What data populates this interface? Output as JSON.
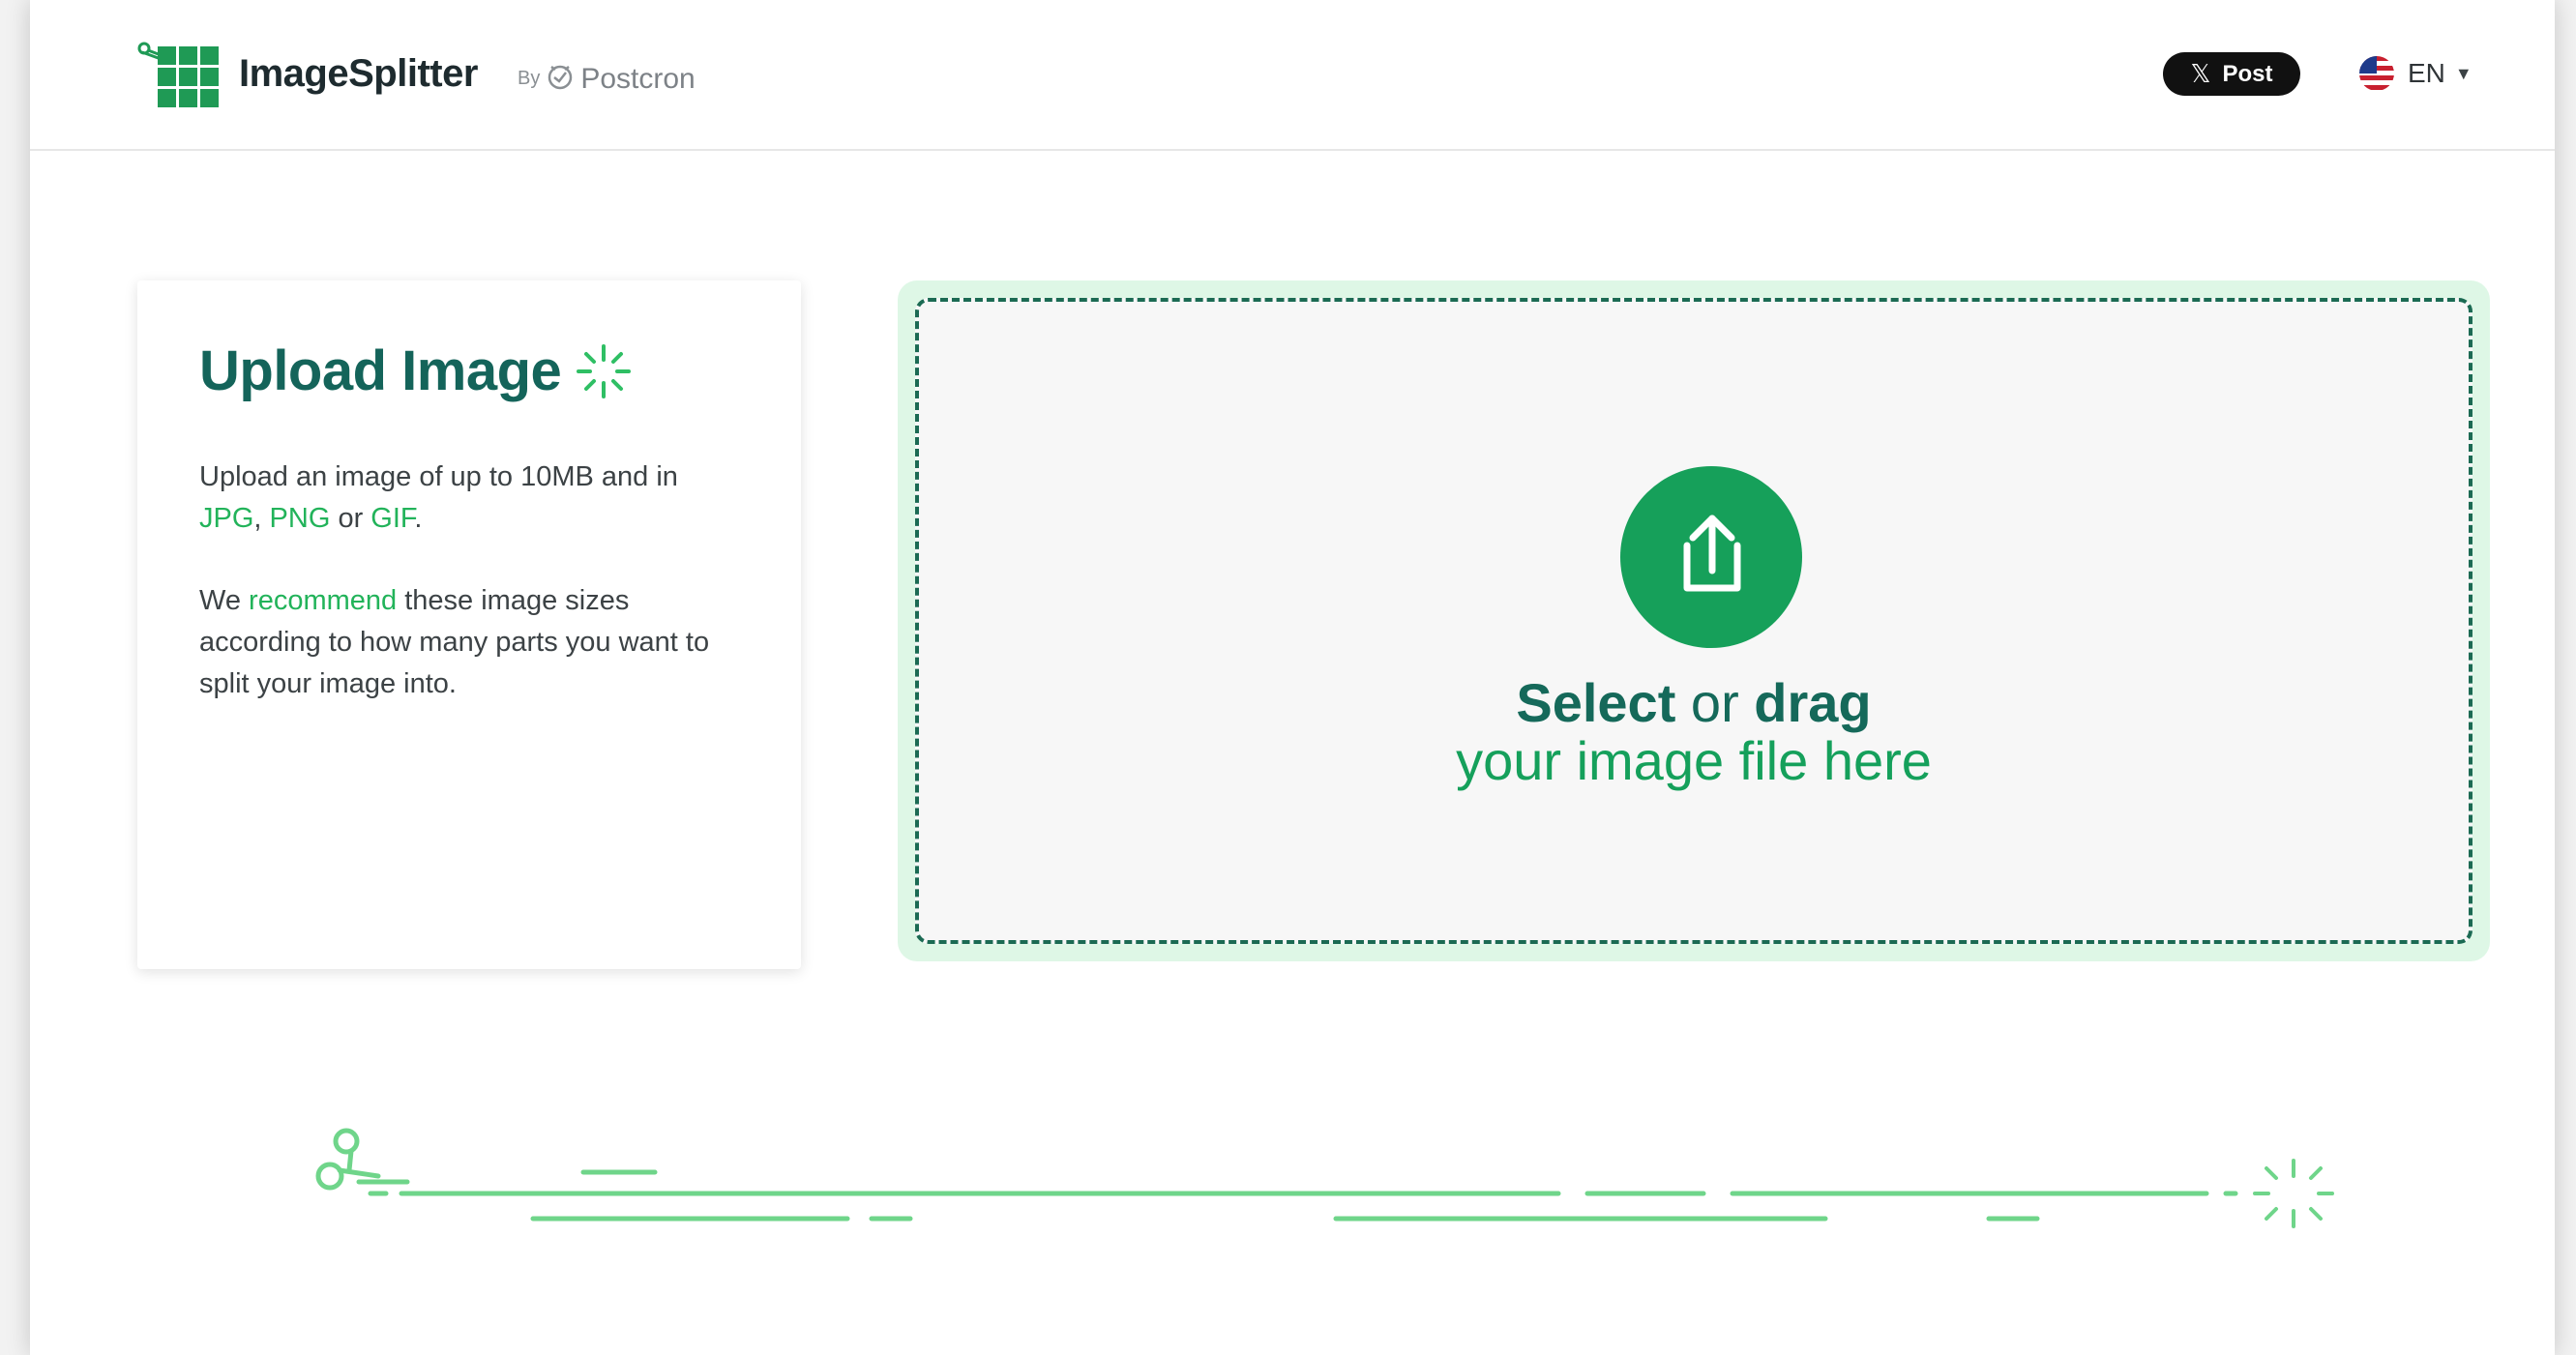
{
  "header": {
    "brand": "ImageSplitter",
    "by_label": "By",
    "partner": "Postcron",
    "post_button": "Post",
    "language": "EN"
  },
  "upload_card": {
    "title": "Upload Image",
    "p1_prefix": "Upload an image of up to 10MB and in",
    "format_jpg": "JPG",
    "sep1": ",",
    "format_png": "PNG",
    "or_word": "or",
    "format_gif": "GIF",
    "period": ".",
    "p2_prefix": "We",
    "recommend_link": "recommend",
    "p2_suffix": "these image sizes according to how many parts you want to split your image into."
  },
  "dropzone": {
    "select_word": "Select",
    "or_word": "or",
    "drag_word": "drag",
    "line2": "your image file here"
  },
  "colors": {
    "brand_green": "#16a05a",
    "dark_teal": "#14645a",
    "link_green": "#22b35a",
    "zone_bg": "#def7e6"
  },
  "icons": [
    "scissors-icon",
    "grid-logo-icon",
    "postcron-icon",
    "x-logo-icon",
    "us-flag-icon",
    "caret-down-icon",
    "sparkle-icon",
    "upload-icon"
  ]
}
